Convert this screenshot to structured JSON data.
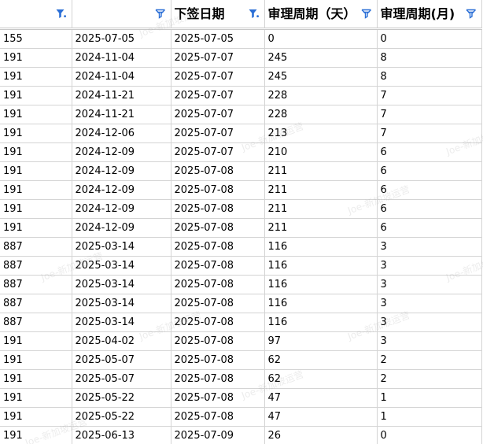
{
  "sheet": {
    "columns": [
      {
        "label": "",
        "filter_active": true
      },
      {
        "label": "",
        "filter_active": false
      },
      {
        "label": "下签日期",
        "filter_active": true
      },
      {
        "label": "审理周期（天）",
        "filter_active": false
      },
      {
        "label": "审理周期(月)",
        "filter_active": false
      }
    ],
    "rows": [
      [
        "155",
        "2025-07-05",
        "2025-07-05",
        "0",
        "0"
      ],
      [
        "191",
        "2024-11-04",
        "2025-07-07",
        "245",
        "8"
      ],
      [
        "191",
        "2024-11-04",
        "2025-07-07",
        "245",
        "8"
      ],
      [
        "191",
        "2024-11-21",
        "2025-07-07",
        "228",
        "7"
      ],
      [
        "191",
        "2024-11-21",
        "2025-07-07",
        "228",
        "7"
      ],
      [
        "191",
        "2024-12-06",
        "2025-07-07",
        "213",
        "7"
      ],
      [
        "191",
        "2024-12-09",
        "2025-07-07",
        "210",
        "6"
      ],
      [
        "191",
        "2024-12-09",
        "2025-07-08",
        "211",
        "6"
      ],
      [
        "191",
        "2024-12-09",
        "2025-07-08",
        "211",
        "6"
      ],
      [
        "191",
        "2024-12-09",
        "2025-07-08",
        "211",
        "6"
      ],
      [
        "191",
        "2024-12-09",
        "2025-07-08",
        "211",
        "6"
      ],
      [
        "887",
        "2025-03-14",
        "2025-07-08",
        "116",
        "3"
      ],
      [
        "887",
        "2025-03-14",
        "2025-07-08",
        "116",
        "3"
      ],
      [
        "887",
        "2025-03-14",
        "2025-07-08",
        "116",
        "3"
      ],
      [
        "887",
        "2025-03-14",
        "2025-07-08",
        "116",
        "3"
      ],
      [
        "887",
        "2025-03-14",
        "2025-07-08",
        "116",
        "3"
      ],
      [
        "191",
        "2025-04-02",
        "2025-07-08",
        "97",
        "3"
      ],
      [
        "191",
        "2025-05-07",
        "2025-07-08",
        "62",
        "2"
      ],
      [
        "191",
        "2025-05-07",
        "2025-07-08",
        "62",
        "2"
      ],
      [
        "191",
        "2025-05-22",
        "2025-07-08",
        "47",
        "1"
      ],
      [
        "191",
        "2025-05-22",
        "2025-07-08",
        "47",
        "1"
      ],
      [
        "191",
        "2025-06-13",
        "2025-07-09",
        "26",
        "0"
      ]
    ]
  },
  "colors": {
    "filter_icon": "#2b6fd6",
    "grid_line": "#d4d4d4"
  },
  "icons": {
    "filter": "funnel-icon",
    "filter_active": "funnel-active-icon"
  },
  "watermark": {
    "text": "Joe-新加坡运营"
  }
}
